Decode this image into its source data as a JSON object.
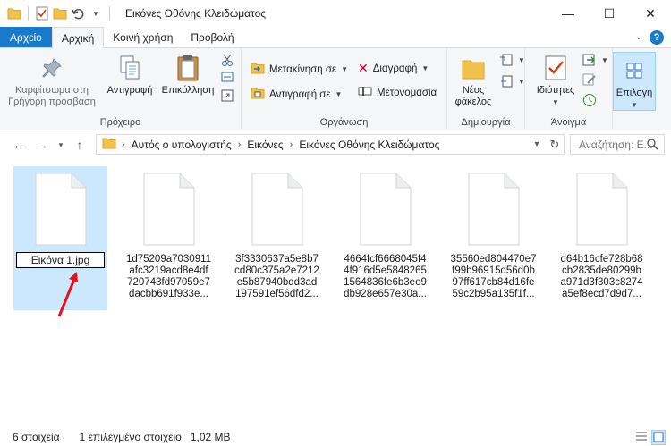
{
  "window": {
    "title": "Εικόνες Οθόνης Κλειδώματος"
  },
  "tabs": [
    {
      "label": "Αρχείο"
    },
    {
      "label": "Αρχική"
    },
    {
      "label": "Κοινή χρήση"
    },
    {
      "label": "Προβολή"
    }
  ],
  "ribbon": {
    "clipboard": {
      "label": "Πρόχειρο",
      "pin": {
        "line1": "Καρφίτσωμα στη",
        "line2": "Γρήγορη πρόσβαση"
      },
      "copy": "Αντιγραφή",
      "paste": "Επικόλληση"
    },
    "organize": {
      "label": "Οργάνωση",
      "move_to": "Μετακίνηση σε",
      "copy_to": "Αντιγραφή σε",
      "delete": "Διαγραφή",
      "rename": "Μετονομασία"
    },
    "new": {
      "label": "Δημιουργία",
      "new_folder": {
        "line1": "Νέος",
        "line2": "φάκελος"
      }
    },
    "open": {
      "label": "Άνοιγμα",
      "properties": "Ιδιότητες"
    },
    "select": {
      "label": "Επιλογή"
    }
  },
  "address": {
    "crumbs": [
      "Αυτός ο υπολογιστής",
      "Εικόνες",
      "Εικόνες Οθόνης Κλειδώματος"
    ],
    "search_placeholder": "Αναζήτηση: Ε..."
  },
  "files": [
    {
      "name": "Εικόνα 1.jpg",
      "selected": true,
      "renaming": true
    },
    {
      "name": "1d75209a7030911afc3219acd8e4df720743fd97059e7dacbb691f933e...",
      "lines": [
        "1d75209a7030911",
        "afc3219acd8e4df",
        "720743fd97059e7",
        "dacbb691f933e..."
      ]
    },
    {
      "name": "3f3330637a5e8b7cd80c375a2e7212e5b87940bdd3ad197591ef56dfd2...",
      "lines": [
        "3f3330637a5e8b7",
        "cd80c375a2e7212",
        "e5b87940bdd3ad",
        "197591ef56dfd2..."
      ]
    },
    {
      "name": "4664fcf6668045f44f916d5e58482651564836fe6b3ee9db928e657e30a...",
      "lines": [
        "4664fcf6668045f4",
        "4f916d5e5848265",
        "1564836fe6b3ee9",
        "db928e657e30a..."
      ]
    },
    {
      "name": "35560ed804470e7f99b96915d56d0b97ff617cb84d16fe59c2b95a135f1f...",
      "lines": [
        "35560ed804470e7",
        "f99b96915d56d0b",
        "97ff617cb84d16fe",
        "59c2b95a135f1f..."
      ]
    },
    {
      "name": "d64b16cfe728b68cb2835de80299ba971d3f303c8274a5ef8ecd7d9d7...",
      "lines": [
        "d64b16cfe728b68",
        "cb2835de80299b",
        "a971d3f303c8274",
        "a5ef8ecd7d9d7..."
      ]
    }
  ],
  "status": {
    "count": "6 στοιχεία",
    "selected": "1 επιλεγμένο στοιχείο",
    "size": "1,02 MB"
  },
  "colors": {
    "accent": "#1979ca",
    "selection": "#cce8ff",
    "arrow": "#e8101a"
  }
}
